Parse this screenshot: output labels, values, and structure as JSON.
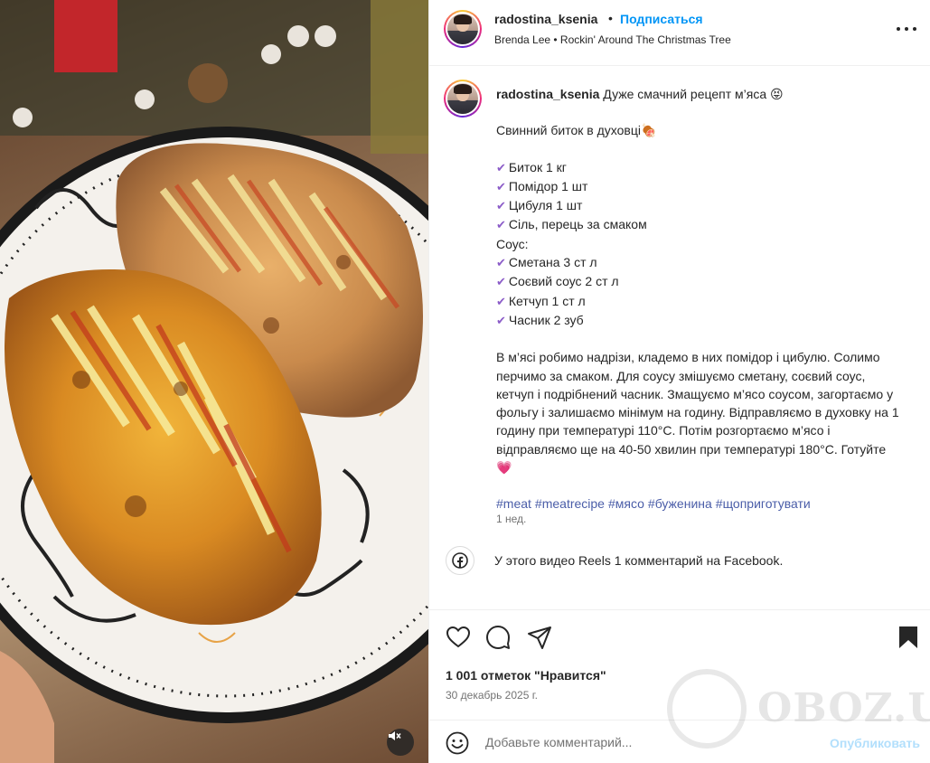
{
  "header": {
    "username": "radostina_ksenia",
    "separator": "•",
    "follow_label": "Подписаться",
    "music": "Brenda Lee • Rockin' Around The Christmas Tree"
  },
  "caption": {
    "username": "radostina_ksenia",
    "intro": "Дуже смачний рецепт м’яса 😝",
    "title": "Свинний биток в духовці🍖",
    "ingredients": [
      "Биток 1 кг",
      "Помідор 1 шт",
      "Цибуля 1 шт",
      "Сіль, перець за смаком"
    ],
    "sauce_label": "Соус:",
    "sauce": [
      "Сметана 3 ст л",
      "Соєвий соус 2 ст л",
      "Кетчуп 1 ст л",
      "Часник 2 зуб"
    ],
    "method": "В м’ясі робимо надрізи, кладемо в них помідор і цибулю. Солимо перчимо за смаком. Для соусу змішуємо сметану, соєвий соус, кетчуп і подрібнений часник. Змащуємо м’ясо соусом, загортаємо у фольгу і залишаємо мінімум на годину. Відправляємо в духовку на 1 годину при температурі 110°C. Потім розгортаємо м’ясо і відправляємо ще на 40-50 хвилин при температурі 180°C. Готуйте",
    "method_emoji": "💗",
    "hashtags": [
      "#meat",
      "#meatrecipe",
      "#мясо",
      "#буженина",
      "#щоприготувати"
    ],
    "time_ago": "1 нед."
  },
  "facebook": {
    "text": "У этого видео Reels 1 комментарий на Facebook."
  },
  "stats": {
    "likes": "1 001 отметок \"Нравится\"",
    "date": "30 декабрь 2025 г."
  },
  "comment": {
    "placeholder": "Добавьте комментарий...",
    "publish_label": "Опубликовать"
  },
  "watermark": {
    "text": "OBOZ.UA"
  },
  "colors": {
    "link_blue": "#0095f6",
    "hashtag": "#4a5da8",
    "check_purple": "#8b5cc8",
    "muted": "#737373"
  }
}
